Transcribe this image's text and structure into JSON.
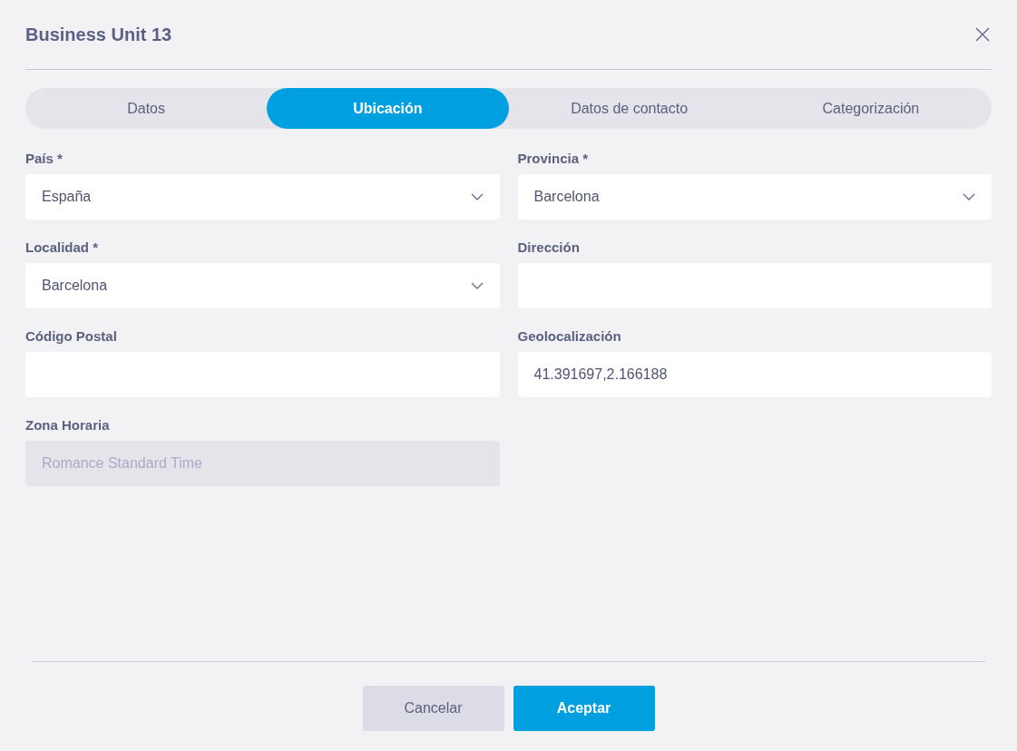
{
  "dialog": {
    "title": "Business Unit 13"
  },
  "tabs": [
    {
      "label": "Datos",
      "selected": false
    },
    {
      "label": "Ubicación",
      "selected": true
    },
    {
      "label": "Datos de contacto",
      "selected": false
    },
    {
      "label": "Categorización",
      "selected": false
    }
  ],
  "fields": [
    {
      "label": "País *",
      "kind": "select",
      "value": "España",
      "disabled": false
    },
    {
      "label": "Provincia *",
      "kind": "select",
      "value": "Barcelona",
      "disabled": false
    },
    {
      "label": "Localidad *",
      "kind": "select",
      "value": "Barcelona",
      "disabled": false
    },
    {
      "label": "Dirección",
      "kind": "text",
      "disabled": false
    },
    {
      "label": "Código Postal",
      "kind": "text",
      "disabled": false
    },
    {
      "label": "Geolocalización",
      "kind": "text",
      "value": "41.391697,2.166188",
      "disabled": false
    },
    {
      "label": "Zona Horaria",
      "kind": "text",
      "value": "Romance Standard Time",
      "disabled": true
    }
  ],
  "buttons": [
    {
      "label": "Cancelar",
      "kind": "secondary"
    },
    {
      "label": "Aceptar",
      "kind": "primary"
    }
  ]
}
